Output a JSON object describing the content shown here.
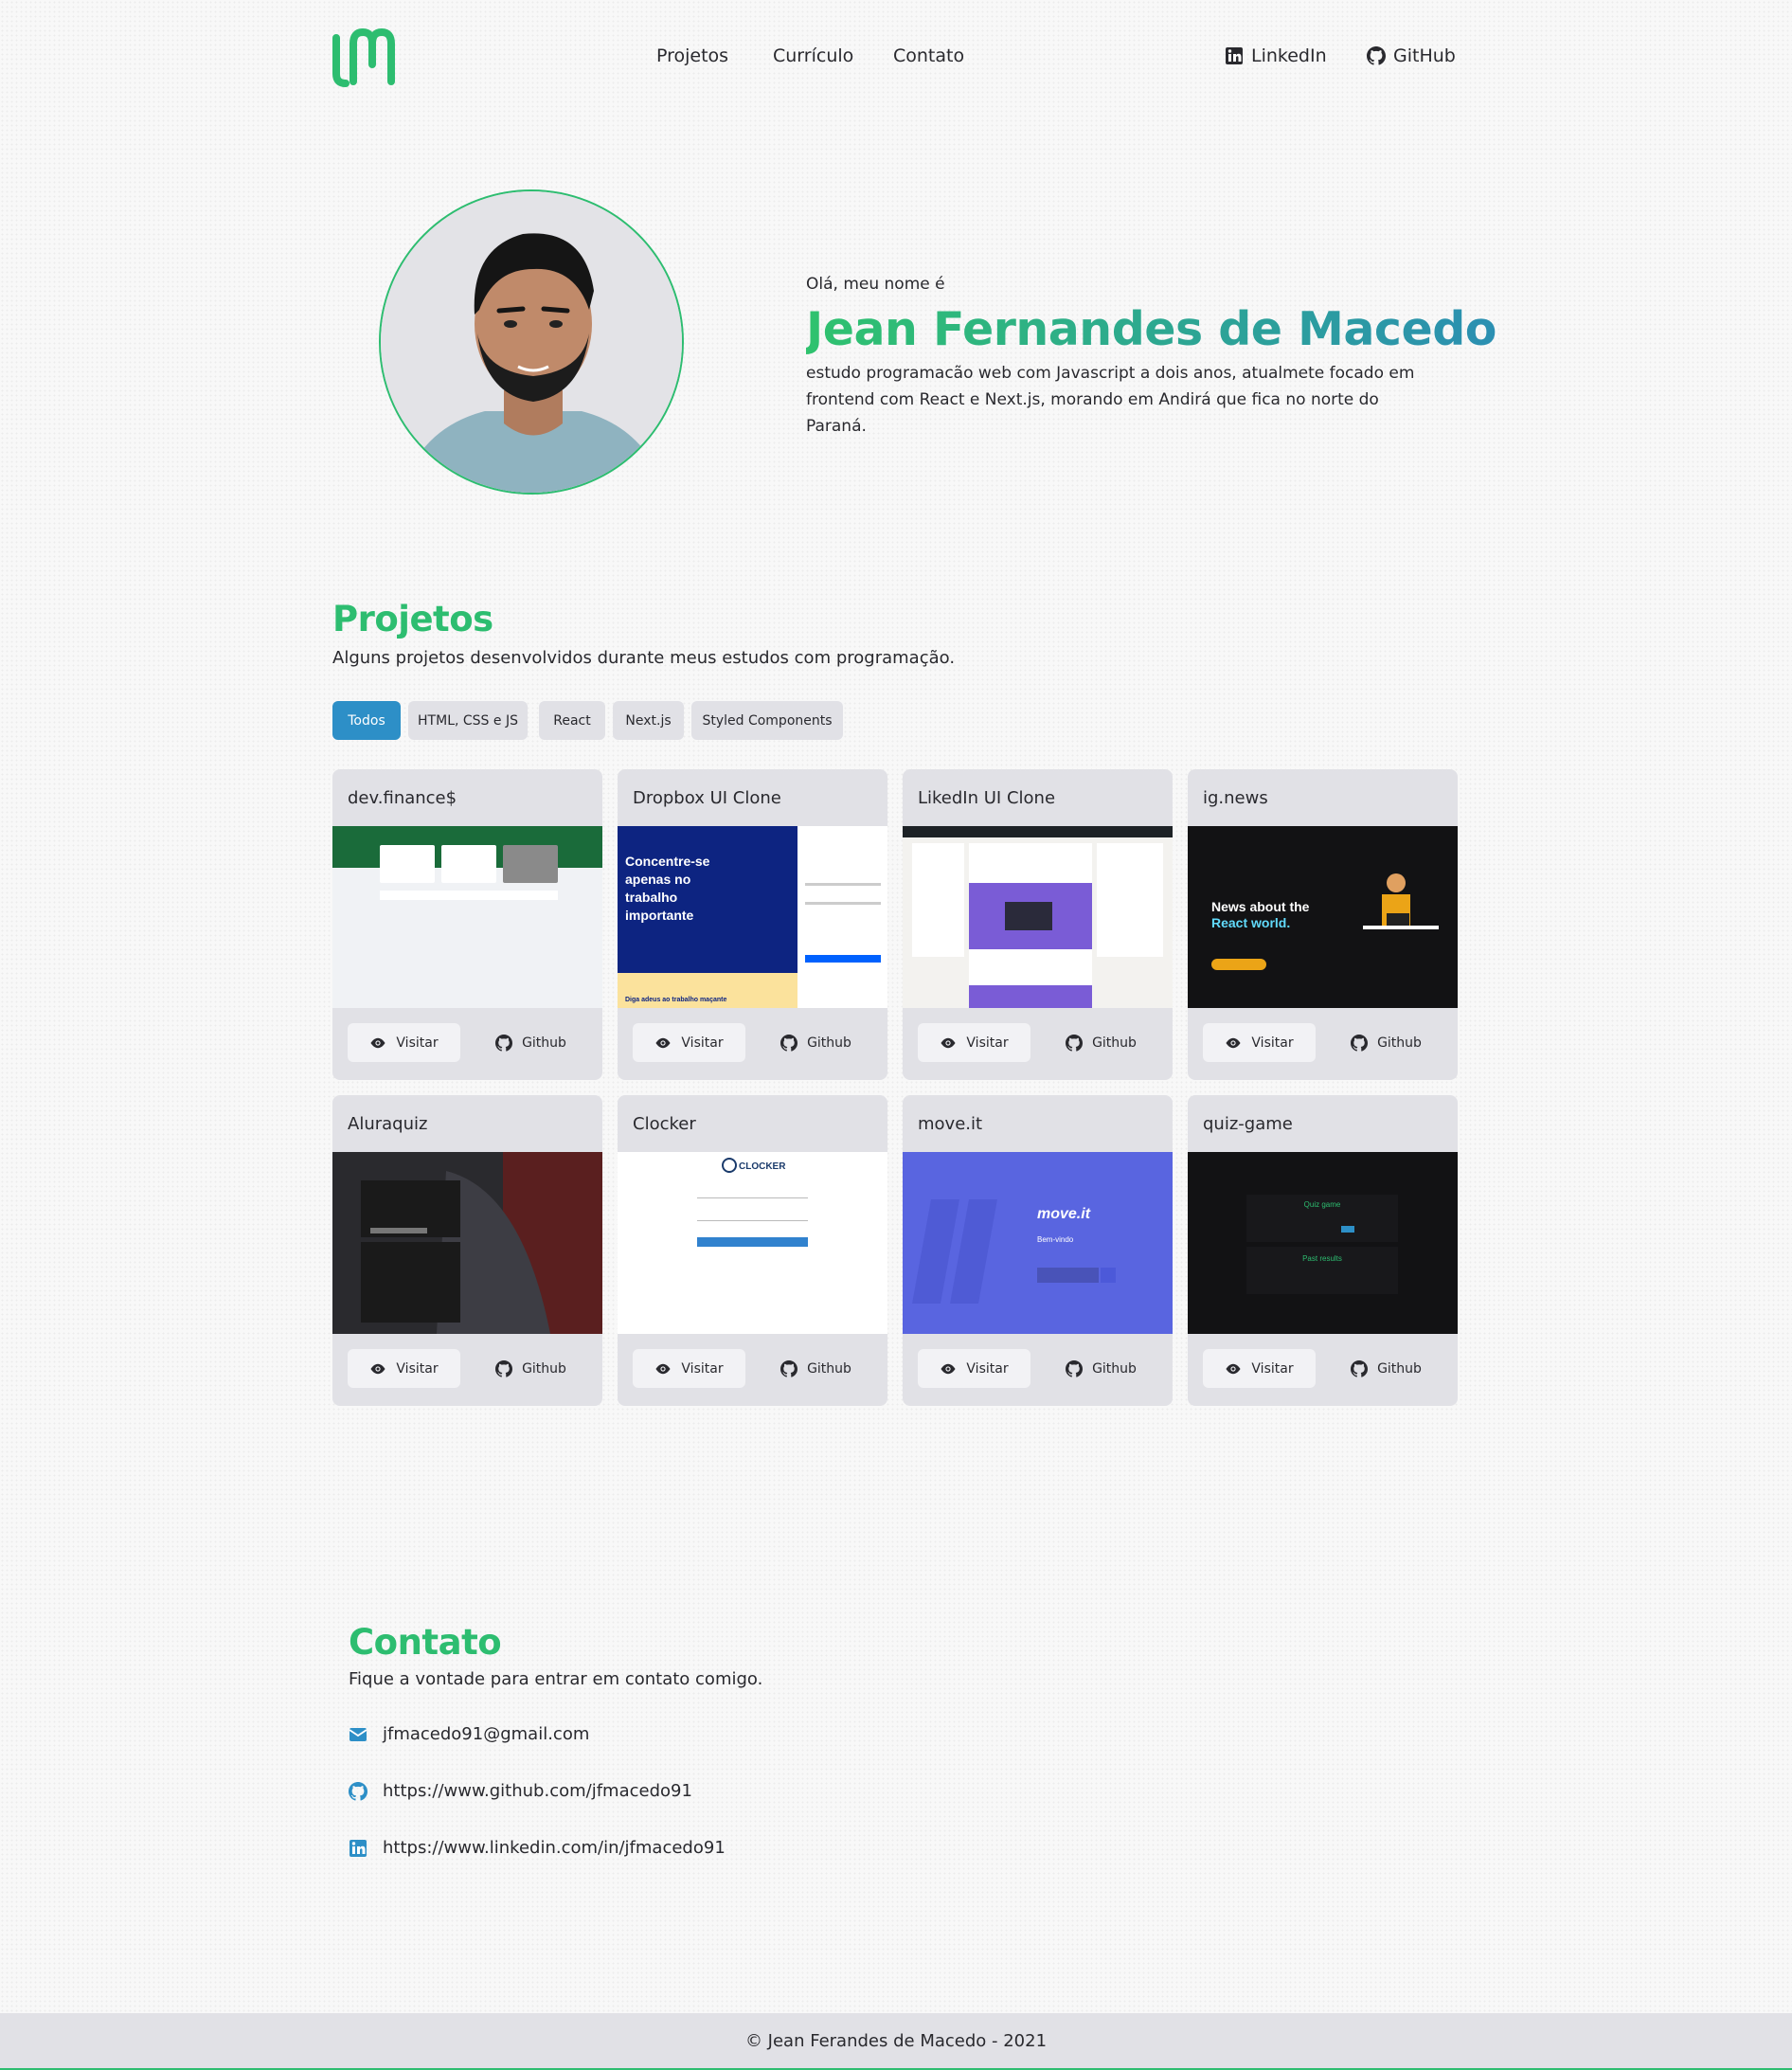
{
  "header": {
    "nav": [
      "Projetos",
      "Currículo",
      "Contato"
    ],
    "social": [
      "LinkedIn",
      "GitHub"
    ]
  },
  "hero": {
    "greeting": "Olá, meu nome é",
    "name": "Jean Fernandes de Macedo",
    "bio": "estudo programacão web com Javascript a dois anos, atualmete focado em frontend com React e Next.js, morando em Andirá que fica no norte do Paraná."
  },
  "projects": {
    "title": "Projetos",
    "subtitle": "Alguns projetos desenvolvidos durante meus estudos com programação.",
    "filters": [
      "Todos",
      "HTML, CSS e JS",
      "React",
      "Next.js",
      "Styled Components"
    ],
    "visit_label": "Visitar",
    "github_label": "Github",
    "cards": [
      {
        "title": "dev.finance$"
      },
      {
        "title": "Dropbox UI Clone",
        "thumb_text": [
          "Concentre-se",
          "apenas no",
          "trabalho",
          "importante"
        ],
        "thumb_footer": "Diga adeus ao trabalho maçante"
      },
      {
        "title": "LikedIn UI Clone"
      },
      {
        "title": "ig.news",
        "thumb_text": [
          "News about the",
          "React world."
        ]
      },
      {
        "title": "Aluraquiz"
      },
      {
        "title": "Clocker",
        "thumb_text": [
          "CLOCKER"
        ]
      },
      {
        "title": "move.it",
        "thumb_text": [
          "move.it",
          "Bem-vindo"
        ]
      },
      {
        "title": "quiz-game",
        "thumb_text": [
          "Quiz game",
          "Past results"
        ]
      }
    ]
  },
  "contact": {
    "title": "Contato",
    "subtitle": "Fique a vontade para entrar em contato comigo.",
    "email": "jfmacedo91@gmail.com",
    "github": "https://www.github.com/jfmacedo91",
    "linkedin": "https://www.linkedin.com/in/jfmacedo91"
  },
  "footer": {
    "text": "© Jean Ferandes de Macedo - 2021"
  },
  "colors": {
    "brand_green": "#2dbd70",
    "accent_blue": "#2d8fc7",
    "card_bg": "#e1e1e6"
  }
}
